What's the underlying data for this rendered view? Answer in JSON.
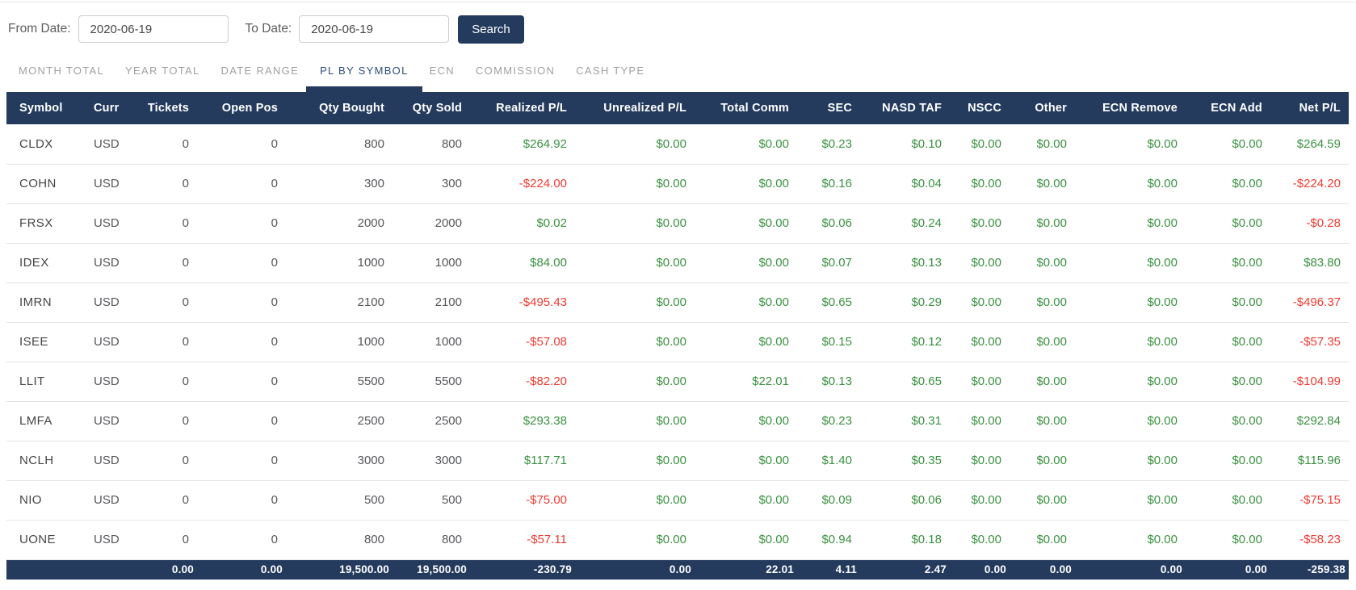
{
  "filter_bar": {
    "from_label": "From Date:",
    "from_value": "2020-06-19",
    "to_label": "To Date:",
    "to_value": "2020-06-19",
    "search_button": "Search"
  },
  "tabs": [
    {
      "label": "MONTH TOTAL",
      "active": false
    },
    {
      "label": "YEAR TOTAL",
      "active": false
    },
    {
      "label": "DATE RANGE",
      "active": false
    },
    {
      "label": "PL BY SYMBOL",
      "active": true
    },
    {
      "label": "ECN",
      "active": false
    },
    {
      "label": "COMMISSION",
      "active": false
    },
    {
      "label": "CASH TYPE",
      "active": false
    }
  ],
  "table": {
    "columns": [
      "Symbol",
      "Curr",
      "Tickets",
      "Open Pos",
      "Qty Bought",
      "Qty Sold",
      "Realized P/L",
      "Unrealized P/L",
      "Total Comm",
      "SEC",
      "NASD TAF",
      "NSCC",
      "Other",
      "ECN Remove",
      "ECN Add",
      "Net P/L"
    ],
    "rows": [
      [
        "CLDX",
        "USD",
        "0",
        "0",
        "800",
        "800",
        "$264.92",
        "$0.00",
        "$0.00",
        "$0.23",
        "$0.10",
        "$0.00",
        "$0.00",
        "$0.00",
        "$0.00",
        "$264.59"
      ],
      [
        "COHN",
        "USD",
        "0",
        "0",
        "300",
        "300",
        "-$224.00",
        "$0.00",
        "$0.00",
        "$0.16",
        "$0.04",
        "$0.00",
        "$0.00",
        "$0.00",
        "$0.00",
        "-$224.20"
      ],
      [
        "FRSX",
        "USD",
        "0",
        "0",
        "2000",
        "2000",
        "$0.02",
        "$0.00",
        "$0.00",
        "$0.06",
        "$0.24",
        "$0.00",
        "$0.00",
        "$0.00",
        "$0.00",
        "-$0.28"
      ],
      [
        "IDEX",
        "USD",
        "0",
        "0",
        "1000",
        "1000",
        "$84.00",
        "$0.00",
        "$0.00",
        "$0.07",
        "$0.13",
        "$0.00",
        "$0.00",
        "$0.00",
        "$0.00",
        "$83.80"
      ],
      [
        "IMRN",
        "USD",
        "0",
        "0",
        "2100",
        "2100",
        "-$495.43",
        "$0.00",
        "$0.00",
        "$0.65",
        "$0.29",
        "$0.00",
        "$0.00",
        "$0.00",
        "$0.00",
        "-$496.37"
      ],
      [
        "ISEE",
        "USD",
        "0",
        "0",
        "1000",
        "1000",
        "-$57.08",
        "$0.00",
        "$0.00",
        "$0.15",
        "$0.12",
        "$0.00",
        "$0.00",
        "$0.00",
        "$0.00",
        "-$57.35"
      ],
      [
        "LLIT",
        "USD",
        "0",
        "0",
        "5500",
        "5500",
        "-$82.20",
        "$0.00",
        "$22.01",
        "$0.13",
        "$0.65",
        "$0.00",
        "$0.00",
        "$0.00",
        "$0.00",
        "-$104.99"
      ],
      [
        "LMFA",
        "USD",
        "0",
        "0",
        "2500",
        "2500",
        "$293.38",
        "$0.00",
        "$0.00",
        "$0.23",
        "$0.31",
        "$0.00",
        "$0.00",
        "$0.00",
        "$0.00",
        "$292.84"
      ],
      [
        "NCLH",
        "USD",
        "0",
        "0",
        "3000",
        "3000",
        "$117.71",
        "$0.00",
        "$0.00",
        "$1.40",
        "$0.35",
        "$0.00",
        "$0.00",
        "$0.00",
        "$0.00",
        "$115.96"
      ],
      [
        "NIO",
        "USD",
        "0",
        "0",
        "500",
        "500",
        "-$75.00",
        "$0.00",
        "$0.00",
        "$0.09",
        "$0.06",
        "$0.00",
        "$0.00",
        "$0.00",
        "$0.00",
        "-$75.15"
      ],
      [
        "UONE",
        "USD",
        "0",
        "0",
        "800",
        "800",
        "-$57.11",
        "$0.00",
        "$0.00",
        "$0.94",
        "$0.18",
        "$0.00",
        "$0.00",
        "$0.00",
        "$0.00",
        "-$58.23"
      ]
    ],
    "totals": [
      "",
      "",
      "0.00",
      "0.00",
      "19,500.00",
      "19,500.00",
      "-230.79",
      "0.00",
      "22.01",
      "4.11",
      "2.47",
      "0.00",
      "0.00",
      "0.00",
      "0.00",
      "-259.38"
    ]
  },
  "colors": {
    "header_navy": "#243B5E",
    "positive_green": "#3A9140",
    "negative_red": "#ED3B32",
    "inactive_tab_gray": "#A0A0A0",
    "active_tab_blue": "#2C4B7C"
  }
}
